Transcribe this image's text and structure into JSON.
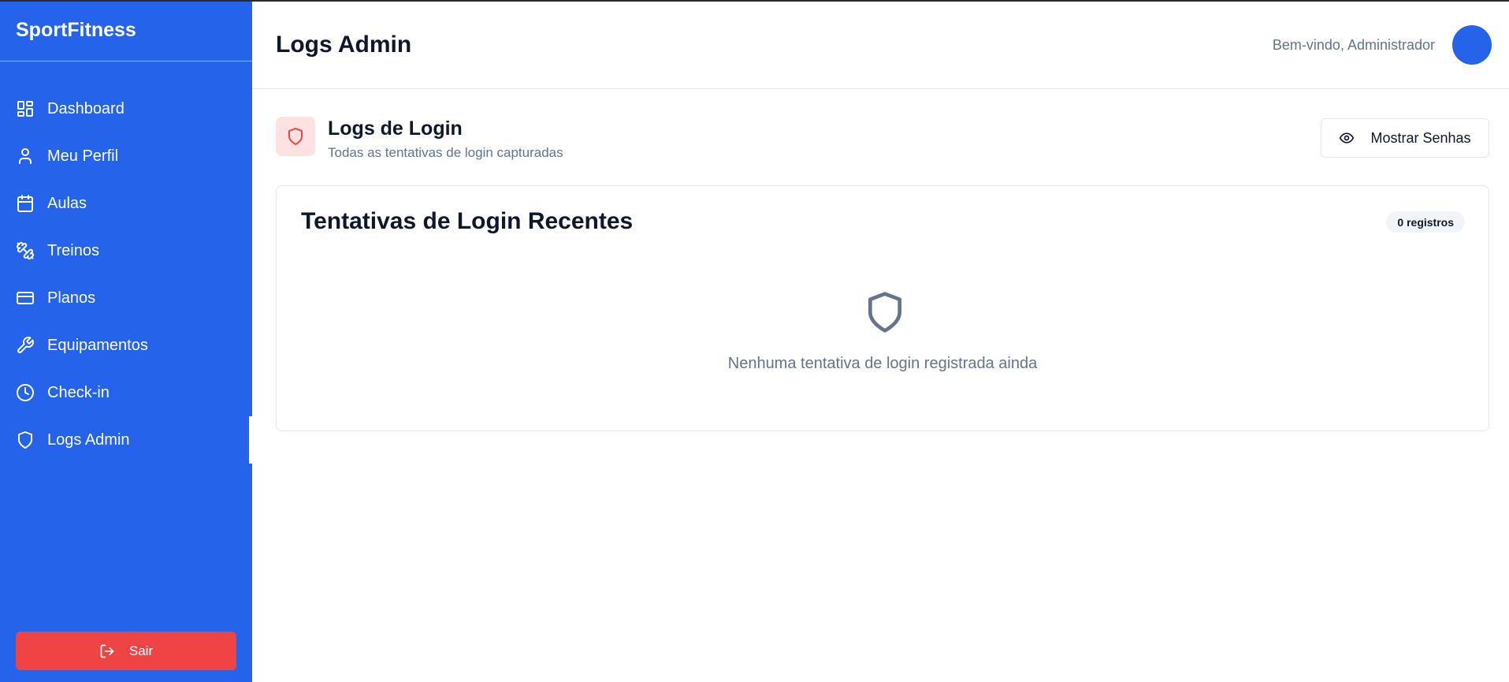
{
  "sidebar": {
    "brand": "SportFitness",
    "items": [
      {
        "label": "Dashboard",
        "icon": "layout-dashboard-icon"
      },
      {
        "label": "Meu Perfil",
        "icon": "user-icon"
      },
      {
        "label": "Aulas",
        "icon": "calendar-icon"
      },
      {
        "label": "Treinos",
        "icon": "dumbbell-icon"
      },
      {
        "label": "Planos",
        "icon": "credit-card-icon"
      },
      {
        "label": "Equipamentos",
        "icon": "wrench-icon"
      },
      {
        "label": "Check-in",
        "icon": "clock-icon"
      },
      {
        "label": "Logs Admin",
        "icon": "shield-icon",
        "active": true
      }
    ],
    "logout_label": "Sair"
  },
  "header": {
    "title": "Logs Admin",
    "welcome": "Bem-vindo, Administrador"
  },
  "section": {
    "title": "Logs de Login",
    "subtitle": "Todas as tentativas de login capturadas",
    "show_passwords_label": "Mostrar Senhas"
  },
  "card": {
    "title": "Tentativas de Login Recentes",
    "badge": "0 registros",
    "empty_text": "Nenhuma tentativa de login registrada ainda"
  },
  "colors": {
    "sidebar_bg": "#2563eb",
    "logout_bg": "#ef4444",
    "shield_accent": "#ef4444",
    "shield_bg": "#fee2e2",
    "muted_text": "#64748b"
  }
}
